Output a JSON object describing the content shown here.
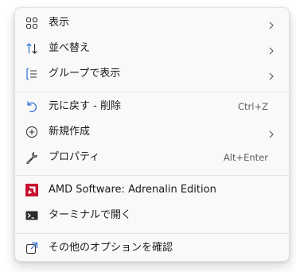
{
  "menu": {
    "items": [
      {
        "label": "表示",
        "icon": "view-grid-icon",
        "has_submenu": true
      },
      {
        "label": "並べ替え",
        "icon": "sort-arrows-icon",
        "has_submenu": true
      },
      {
        "label": "グループで表示",
        "icon": "group-list-icon",
        "has_submenu": true
      },
      {
        "label": "元に戻す - 削除",
        "icon": "undo-icon",
        "shortcut": "Ctrl+Z"
      },
      {
        "label": "新規作成",
        "icon": "new-plus-icon",
        "has_submenu": true
      },
      {
        "label": "プロパティ",
        "icon": "wrench-icon",
        "shortcut": "Alt+Enter"
      },
      {
        "label": "AMD Software: Adrenalin Edition",
        "icon": "amd-logo-icon"
      },
      {
        "label": "ターミナルで開く",
        "icon": "terminal-icon"
      },
      {
        "label": "その他のオプションを確認",
        "icon": "more-options-icon"
      }
    ]
  },
  "colors": {
    "accent_blue": "#2a6fd1",
    "amd_red": "#c8102e"
  }
}
